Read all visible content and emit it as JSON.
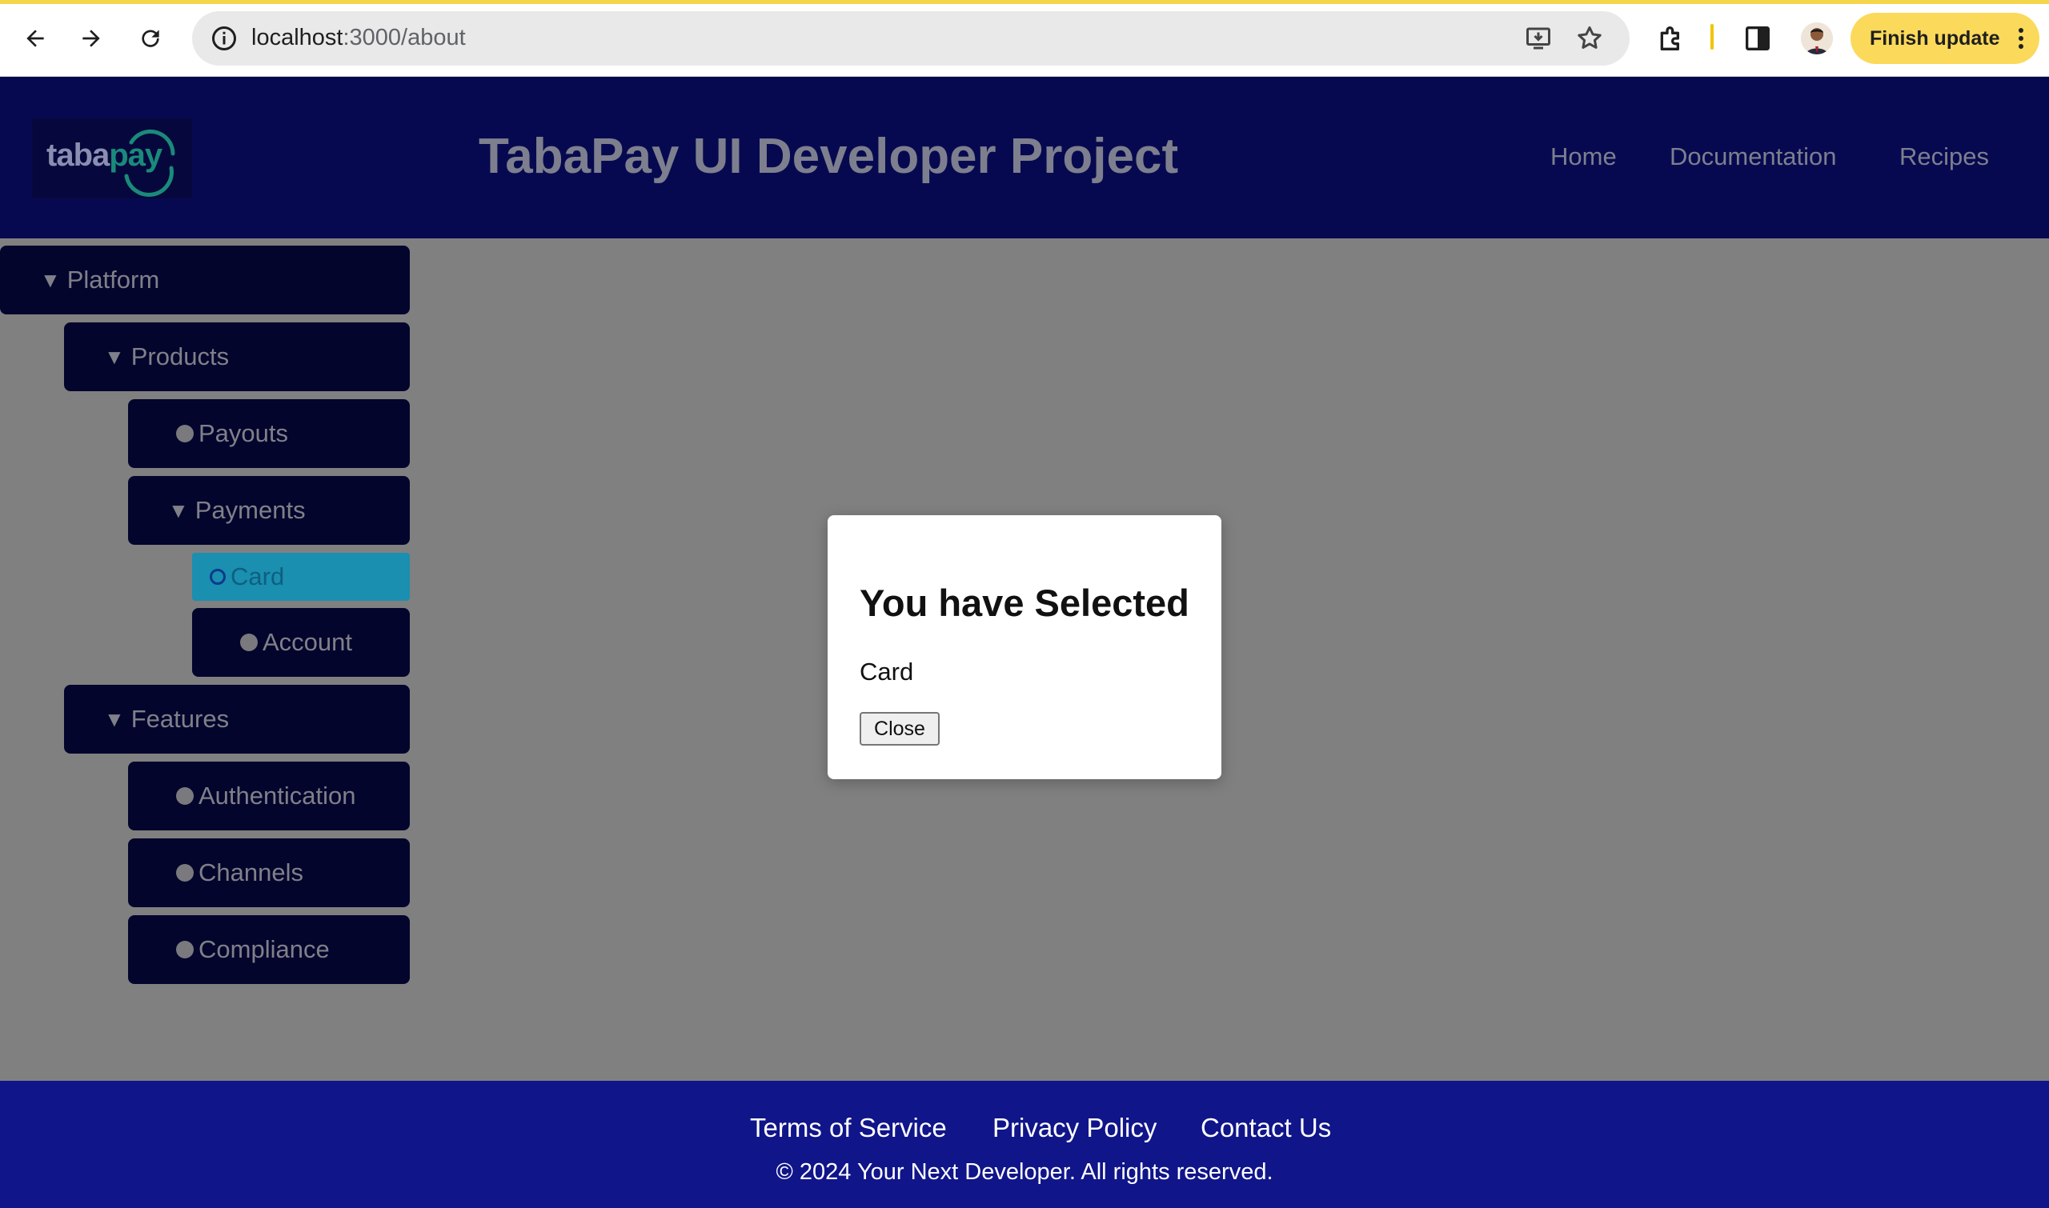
{
  "browser": {
    "url_host": "localhost",
    "url_path": ":3000/about",
    "finish_update_label": "Finish update",
    "icons": [
      "back-arrow-icon",
      "forward-arrow-icon",
      "reload-icon",
      "site-info-icon",
      "install-app-icon",
      "bookmark-star-icon",
      "extensions-puzzle-icon",
      "side-panel-icon",
      "profile-avatar",
      "kebab-menu-icon"
    ]
  },
  "header": {
    "logo_text_a": "taba",
    "logo_text_b": "pay",
    "title": "TabaPay UI Developer Project",
    "nav": {
      "home": "Home",
      "documentation": "Documentation",
      "recipes": "Recipes"
    }
  },
  "tree": {
    "platform": "Platform",
    "products": "Products",
    "payouts": "Payouts",
    "payments": "Payments",
    "card": "Card",
    "account": "Account",
    "features": "Features",
    "authentication": "Authentication",
    "channels": "Channels",
    "compliance": "Compliance"
  },
  "modal": {
    "heading": "You have Selected",
    "selected_value": "Card",
    "close_label": "Close"
  },
  "footer": {
    "terms": "Terms of Service",
    "privacy": "Privacy Policy",
    "contact": "Contact Us",
    "copyright": "© 2024 Your Next Developer. All rights reserved."
  },
  "colors": {
    "header_bg": "#070950",
    "footer_bg": "#10158a",
    "overlay": "#808080",
    "selected_node": "#1a8fb0",
    "update_button": "#fbd95a"
  }
}
